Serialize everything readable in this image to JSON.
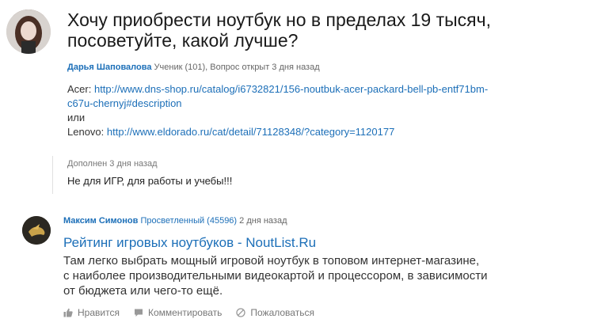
{
  "question": {
    "title_line1": "Хочу приобрести ноутбук но в пределах 19 тысяч,",
    "title_line2": "посоветуйте, какой лучше?",
    "author": "Дарья Шаповалова",
    "meta": "Ученик (101), Вопрос открыт 3 дня назад",
    "acer_label": "Acer:",
    "acer_link_line1": "http://www.dns-shop.ru/catalog/i6732821/156-noutbuk-acer-packard-bell-pb-entf71bm-",
    "acer_link_line2": "c67u-chernyj#description",
    "or_text": "или",
    "lenovo_label": "Lenovo:",
    "lenovo_link": "http://www.eldorado.ru/cat/detail/71128348/?category=1120177"
  },
  "addition": {
    "label": "Дополнен 3 дня назад",
    "text": "Не для ИГР, для работы и учебы!!!"
  },
  "answer": {
    "author": "Максим Симонов",
    "rank": "Просветленный (45596)",
    "time": "2 дня назад",
    "link_text": "Рейтинг игровых ноутбуков - NoutList.Ru",
    "body_line1": "Там легко выбрать мощный игровой ноутбук в топовом интернет-магазине,",
    "body_line2": "с наиболее производительными видеокартой и процессором, в зависимости",
    "body_line3": "от бюджета или чего-то ещё."
  },
  "actions": {
    "like": "Нравится",
    "comment": "Комментировать",
    "report": "Пожаловаться"
  },
  "colors": {
    "link": "#1c6fb8",
    "text": "#333333",
    "meta": "#666666"
  },
  "icons": [
    "thumbs-up-icon",
    "comment-icon",
    "report-icon"
  ]
}
